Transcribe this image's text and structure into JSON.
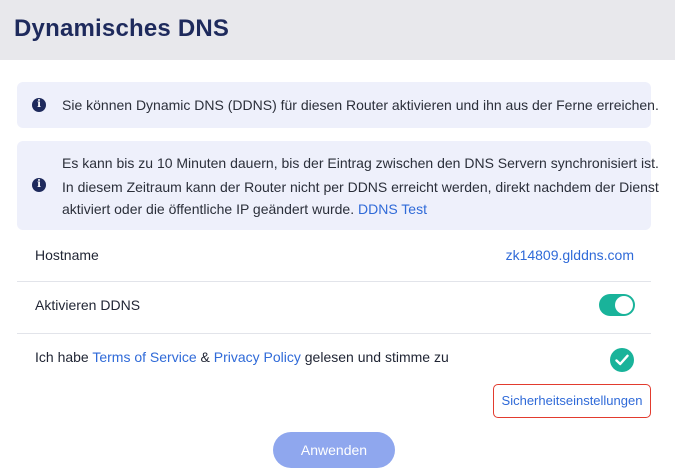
{
  "header": {
    "title": "Dynamisches DNS"
  },
  "info1": {
    "text": "Sie können Dynamic DNS (DDNS) für diesen Router aktivieren und ihn aus der Ferne erreichen."
  },
  "info2": {
    "line1": "Es kann bis zu 10 Minuten dauern, bis der Eintrag zwischen den DNS Servern synchronisiert ist.",
    "line2": "In diesem Zeitraum kann der Router nicht per DDNS erreicht werden, direkt nachdem der Dienst",
    "line3": "aktiviert oder die öffentliche IP geändert wurde.",
    "link": "DDNS Test"
  },
  "hostname": {
    "label": "Hostname",
    "value": "zk14809.glddns.com"
  },
  "ddns": {
    "label": "Aktivieren DDNS",
    "enabled": true
  },
  "tos": {
    "prefix": "Ich habe",
    "terms_link": "Terms of Service",
    "amp": "&",
    "privacy_link": "Privacy Policy",
    "suffix": "gelesen und stimme zu",
    "checked": true
  },
  "buttons": {
    "security": "Sicherheitseinstellungen",
    "apply": "Anwenden"
  },
  "colors": {
    "accent": "#19b39a",
    "link": "#2f6ad8",
    "highlight_border": "#e23b2e",
    "apply_button": "#8fa7ee",
    "title": "#1e2a5c"
  },
  "icons": {
    "info": "info-icon",
    "check": "check-icon",
    "toggle": "toggle-switch"
  }
}
